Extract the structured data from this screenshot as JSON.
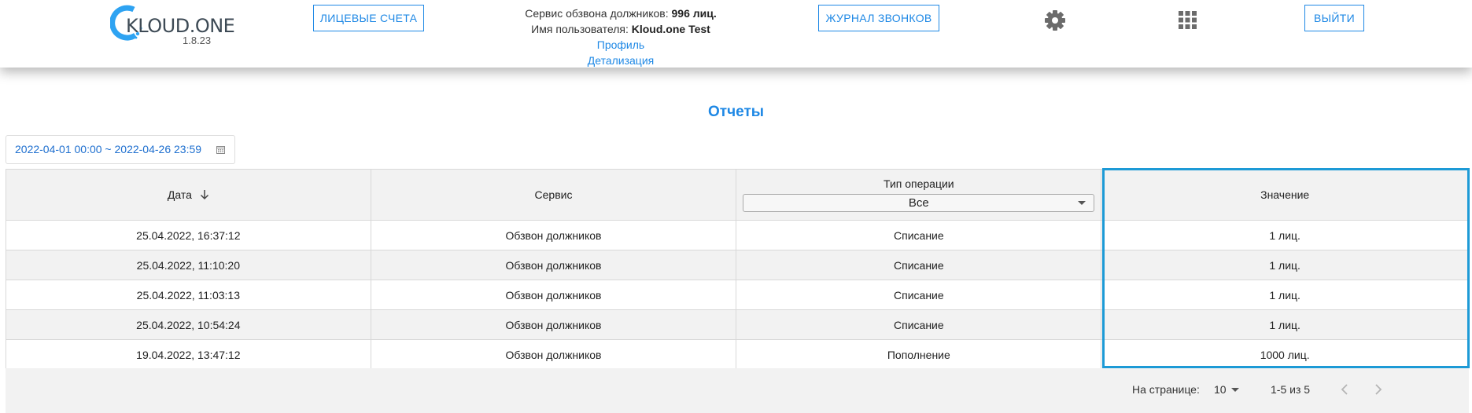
{
  "header": {
    "logo_name": "KLOUD.ONE",
    "logo_version": "1.8.23",
    "accounts_button": "ЛИЦЕВЫЕ СЧЕТА",
    "journal_button": "ЖУРНАЛ ЗВОНКОВ",
    "logout_button": "ВЫЙТИ",
    "service_label": "Сервис обзвона должников:",
    "service_value": "996 лиц.",
    "user_label": "Имя пользователя:",
    "user_value": "Kloud.one Test",
    "profile_link": "Профиль",
    "details_link": "Детализация",
    "icons": [
      "gear-icon",
      "apps-grid-icon"
    ]
  },
  "page": {
    "title": "Отчеты",
    "date_range": "2022-04-01 00:00 ~ 2022-04-26 23:59"
  },
  "table": {
    "columns": {
      "date": "Дата",
      "service": "Сервис",
      "op_type": "Тип операции",
      "value": "Значение"
    },
    "op_type_filter": "Все",
    "rows": [
      {
        "date": "25.04.2022, 16:37:12",
        "service": "Обзвон должников",
        "op_type": "Списание",
        "value": "1 лиц."
      },
      {
        "date": "25.04.2022, 11:10:20",
        "service": "Обзвон должников",
        "op_type": "Списание",
        "value": "1 лиц."
      },
      {
        "date": "25.04.2022, 11:03:13",
        "service": "Обзвон должников",
        "op_type": "Списание",
        "value": "1 лиц."
      },
      {
        "date": "25.04.2022, 10:54:24",
        "service": "Обзвон должников",
        "op_type": "Списание",
        "value": "1 лиц."
      },
      {
        "date": "19.04.2022, 13:47:12",
        "service": "Обзвон должников",
        "op_type": "Пополнение",
        "value": "1000 лиц."
      }
    ]
  },
  "pagination": {
    "per_page_label": "На странице:",
    "per_page_value": "10",
    "range": "1-5 из 5"
  },
  "colors": {
    "accent": "#1e88e5",
    "highlight": "#1d9ad6",
    "stripe": "#f2f2f2"
  }
}
